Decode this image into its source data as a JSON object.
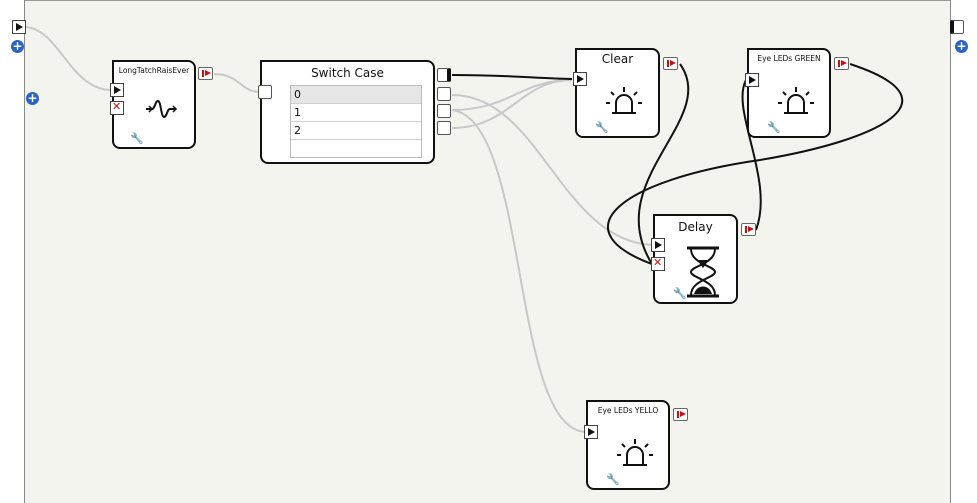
{
  "boxes": {
    "long_touch": {
      "title": "LongTatchRaisEver"
    },
    "switch_case": {
      "title": "Switch Case",
      "cases": [
        "0",
        "1",
        "2",
        ""
      ]
    },
    "clear": {
      "title": "Clear"
    },
    "eye_green": {
      "title": "Eye LEDs GREEN"
    },
    "delay": {
      "title": "Delay"
    },
    "eye_yellow": {
      "title": "Eye LEDs YELLO"
    }
  },
  "icons": {
    "wrench": "wrench-icon",
    "led": "led-light-icon",
    "hourglass": "hourglass-icon",
    "touch": "touch-wave-icon",
    "plus": "add-port-icon"
  },
  "colors": {
    "canvas": "#f4f4ee",
    "wire_active": "#111111",
    "wire_idle": "#c8c8c8",
    "stop_red": "#d01010",
    "plus_blue": "#2a63c9"
  },
  "plus_glyph": "+"
}
